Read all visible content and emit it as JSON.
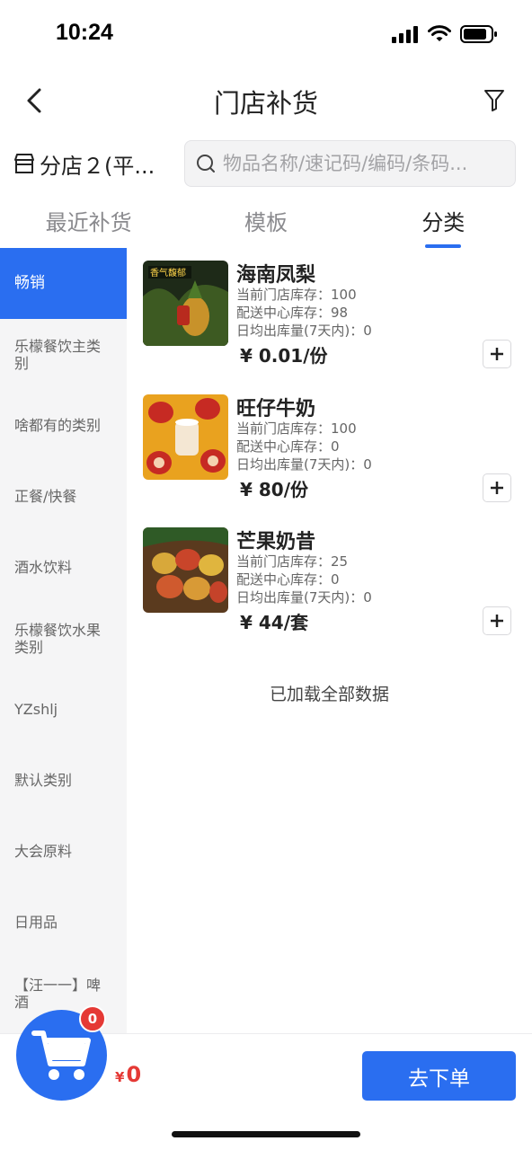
{
  "status_bar": {
    "time": "10:24"
  },
  "nav": {
    "title": "门店补货"
  },
  "store": {
    "name": "分店２(平...",
    "placeholder": "物品名称/速记码/编码/条码..."
  },
  "tabs": [
    {
      "label": "最近补货",
      "active": false
    },
    {
      "label": "模板",
      "active": false
    },
    {
      "label": "分类",
      "active": true
    }
  ],
  "sidebar": {
    "items": [
      {
        "label": "畅销",
        "active": true
      },
      {
        "label": "乐檬餐饮主类别"
      },
      {
        "label": "啥都有的类别"
      },
      {
        "label": "正餐/快餐"
      },
      {
        "label": "酒水饮料"
      },
      {
        "label": "乐檬餐饮水果类别"
      },
      {
        "label": "YZshlj"
      },
      {
        "label": "默认类别"
      },
      {
        "label": "大会原料"
      },
      {
        "label": "日用品"
      },
      {
        "label": "【汪一一】啤酒"
      }
    ]
  },
  "products": [
    {
      "name": "海南凤梨",
      "store_stock": "当前门店库存：100",
      "center_stock": "配送中心库存：98",
      "daily_out": "日均出库量(7天内)：0",
      "price": "¥ 0.01/份",
      "image_label": "香气馥郁"
    },
    {
      "name": "旺仔牛奶",
      "store_stock": "当前门店库存：100",
      "center_stock": "配送中心库存：0",
      "daily_out": "日均出库量(7天内)：0",
      "price": "¥ 80/份"
    },
    {
      "name": "芒果奶昔",
      "store_stock": "当前门店库存：25",
      "center_stock": "配送中心库存：0",
      "daily_out": "日均出库量(7天内)：0",
      "price": "¥ 44/套"
    }
  ],
  "loaded_text": "已加载全部数据",
  "cart": {
    "badge": "0",
    "currency": "¥",
    "total": "0"
  },
  "order_button": "去下单",
  "colors": {
    "accent": "#2a6ef0",
    "price_red": "#e53935"
  }
}
